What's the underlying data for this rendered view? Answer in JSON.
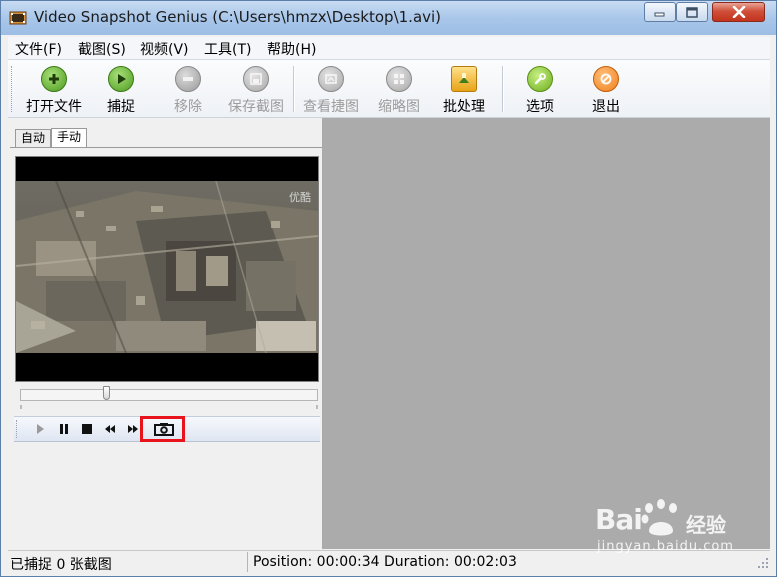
{
  "window": {
    "title": "Video Snapshot Genius (C:\\Users\\hmzx\\Desktop\\1.avi)"
  },
  "menu": {
    "items": [
      "文件(F)",
      "截图(S)",
      "视频(V)",
      "工具(T)",
      "帮助(H)"
    ]
  },
  "toolbar": {
    "buttons": [
      {
        "label": "打开文件",
        "icon": "plus-icon",
        "color": "#5aa02c",
        "enabled": true
      },
      {
        "label": "捕捉",
        "icon": "play-icon",
        "color": "#5aa02c",
        "enabled": true
      },
      {
        "label": "移除",
        "icon": "minus-icon",
        "color": "#9a9a9a",
        "enabled": false
      },
      {
        "label": "保存截图",
        "icon": "save-icon",
        "color": "#9a9a9a",
        "enabled": false
      },
      {
        "label": "查看捷图",
        "icon": "view-icon",
        "color": "#9a9a9a",
        "enabled": false
      },
      {
        "label": "缩略图",
        "icon": "thumbnail-icon",
        "color": "#9a9a9a",
        "enabled": false
      },
      {
        "label": "批处理",
        "icon": "batch-icon",
        "color": "#e8a317",
        "enabled": true
      },
      {
        "label": "选项",
        "icon": "wrench-icon",
        "color": "#7ab929",
        "enabled": true
      },
      {
        "label": "退出",
        "icon": "exit-icon",
        "color": "#f07f1b",
        "enabled": true
      }
    ]
  },
  "tabs": [
    {
      "label": "自动",
      "active": false
    },
    {
      "label": "手动",
      "active": true
    }
  ],
  "player": {
    "watermark": "优酷",
    "seek_fraction": 0.28
  },
  "controls": [
    "play-icon",
    "pause-icon",
    "stop-icon",
    "rewind-icon",
    "fast-forward-icon",
    "snapshot-camera-icon"
  ],
  "status": {
    "left": "已捕捉 0 张截图",
    "right": "Position: 00:00:34 Duration: 00:02:03"
  },
  "brand": {
    "main": "Bai",
    "cn": "经验",
    "url": "jingyan.baidu.com"
  },
  "colors": {
    "highlight": "#e8131b",
    "right_pane": "#ababab"
  }
}
